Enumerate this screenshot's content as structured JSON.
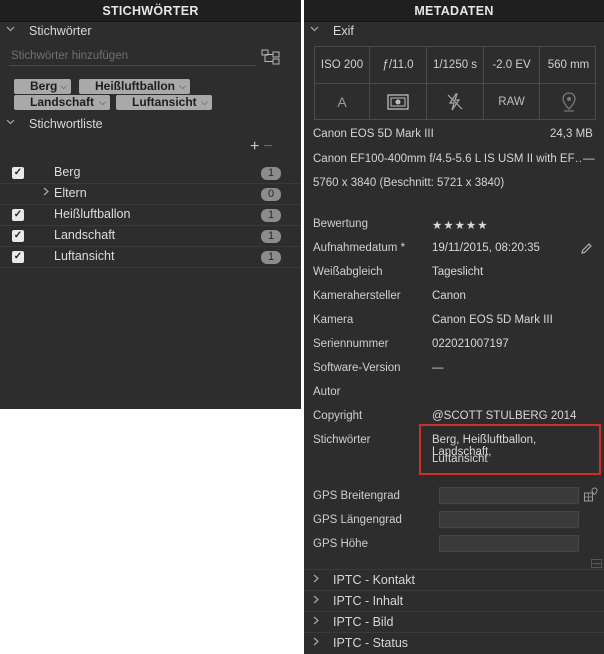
{
  "left": {
    "title": "STICHWÖRTER",
    "section1": "Stichwörter",
    "input_placeholder": "Stichwörter hinzufügen",
    "chips": [
      {
        "label": "Berg"
      },
      {
        "label": "Heißluftballon"
      },
      {
        "label": "Landschaft"
      },
      {
        "label": "Luftansicht"
      }
    ],
    "section2": "Stichwortliste",
    "add_symbol": "+",
    "remove_symbol": "−",
    "keywords": [
      {
        "name": "Berg",
        "count": "1",
        "checked": true
      },
      {
        "name": "Eltern",
        "count": "0",
        "checked": false
      },
      {
        "name": "Heißluftballon",
        "count": "1",
        "checked": true
      },
      {
        "name": "Landschaft",
        "count": "1",
        "checked": true
      },
      {
        "name": "Luftansicht",
        "count": "1",
        "checked": true
      }
    ]
  },
  "right": {
    "title": "METADATEN",
    "section_exif": "Exif",
    "exif_top": [
      "ISO 200",
      "ƒ/11.0",
      "1/1250 s",
      "-2.0 EV",
      "560 mm"
    ],
    "exif_bottom": [
      "A",
      "",
      "",
      "RAW",
      ""
    ],
    "exif_icons": [
      "auto-mode",
      "metering-icon",
      "flash-off-icon",
      "raw-format",
      "location-pin-icon"
    ],
    "camera_line": "Canon EOS 5D Mark III",
    "file_size": "24,3 MB",
    "lens_line": "Canon EF100-400mm f/4.5-5.6 L IS USM II with EF…",
    "lens_dash": "—",
    "dimensions": "5760 x 3840 (Beschnitt: 5721 x 3840)",
    "rating_label": "Bewertung",
    "rating_stars": "★★★★★",
    "rows": [
      {
        "key": "Aufnahmedatum *",
        "value": "19/11/2015, 08:20:35"
      },
      {
        "key": "Weißabgleich",
        "value": "Tageslicht"
      },
      {
        "key": "Kamerahersteller",
        "value": "Canon"
      },
      {
        "key": "Kamera",
        "value": "Canon EOS 5D Mark III"
      },
      {
        "key": "Seriennummer",
        "value": "022021007197"
      },
      {
        "key": "Software-Version",
        "value": "—"
      },
      {
        "key": "Autor",
        "value": ""
      },
      {
        "key": "Copyright",
        "value": "@SCOTT STULBERG 2014"
      }
    ],
    "keywords_label": "Stichwörter",
    "keywords_value_line1": "Berg, Heißluftballon, Landschaft,",
    "keywords_value_line2": "Luftansicht",
    "gps": [
      {
        "key": "GPS Breitengrad"
      },
      {
        "key": "GPS Längengrad"
      },
      {
        "key": "GPS Höhe"
      }
    ],
    "collapse_symbol": "—",
    "iptc_sections": [
      "IPTC - Kontakt",
      "IPTC - Inhalt",
      "IPTC - Bild",
      "IPTC - Status"
    ]
  }
}
